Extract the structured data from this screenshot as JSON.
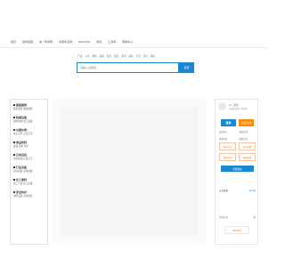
{
  "topnav": {
    "items": [
      "首页",
      "招商加盟",
      "第一商务网",
      "中国商业网",
      "ENGLISH",
      "新闻",
      "工商库",
      "帮助中心"
    ]
  },
  "search": {
    "tabs": [
      "产品",
      "公司",
      "求购",
      "品牌",
      "招商",
      "展会",
      "资讯",
      "采购",
      "行业",
      "百科",
      "图库"
    ],
    "placeholder": "请输入关键词",
    "button": "搜索"
  },
  "categories": [
    {
      "title": "服装服饰",
      "links": "服装面料 服装辅料"
    },
    {
      "title": "机械设备",
      "links": "通用机械 加工设备"
    },
    {
      "title": "仪器仪表",
      "links": "电子元件 五金工具"
    },
    {
      "title": "食品饮料",
      "links": "食品 饮料 茶叶"
    },
    {
      "title": "日用百货",
      "links": "家居用品 礼品工艺"
    },
    {
      "title": "行业设备",
      "links": "商业设备 专用设备"
    },
    {
      "title": "化工原料",
      "links": "化工产品 化工设备"
    },
    {
      "title": "安全防护",
      "links": "消防设备 安防监控"
    }
  ],
  "user": {
    "greeting": "Hi，您好！",
    "welcome": "欢迎来到第一商务网",
    "login": "登录",
    "register": "免费注册",
    "links": [
      "会员中心",
      "发布信息",
      "采购专区",
      "招商专区"
    ],
    "tiles": [
      "发布产品",
      "发布求购",
      "我的店铺",
      "商铺装修"
    ],
    "free_button": "免费建站",
    "stats_label": "会员数量",
    "stats_value": "96.3万",
    "bottom_left": "已有产品",
    "bottom_right": "条",
    "count": "356229"
  }
}
